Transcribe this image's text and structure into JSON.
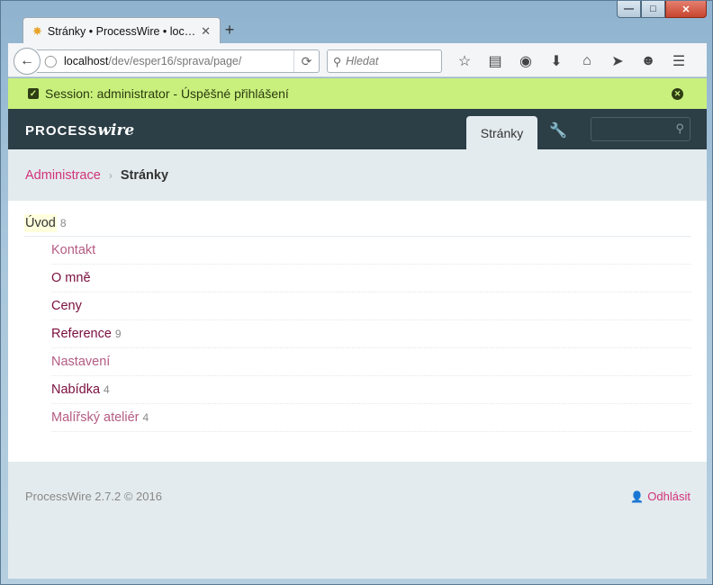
{
  "browser": {
    "tab_title": "Stránky • ProcessWire • loc…",
    "new_tab": "+",
    "url_host": "localhost",
    "url_path": "/dev/esper16/sprava/page/",
    "search_placeholder": "Hledat"
  },
  "notice": {
    "text": "Session: administrator - Úspěšné přihlášení"
  },
  "header": {
    "logo_main": "PROCESS",
    "logo_italic": "wire",
    "nav_tab": "Stránky"
  },
  "breadcrumb": {
    "parent": "Administrace",
    "current": "Stránky"
  },
  "tree": {
    "root": {
      "label": "Úvod",
      "count": "8"
    },
    "children": [
      {
        "label": "Kontakt",
        "count": ""
      },
      {
        "label": "O mně",
        "count": ""
      },
      {
        "label": "Ceny",
        "count": ""
      },
      {
        "label": "Reference",
        "count": "9"
      },
      {
        "label": "Nastavení",
        "count": ""
      },
      {
        "label": "Nabídka",
        "count": "4"
      },
      {
        "label": "Malířský ateliér",
        "count": "4"
      }
    ]
  },
  "footer": {
    "version": "ProcessWire 2.7.2 © 2016",
    "logout": "Odhlásit"
  },
  "colors": {
    "accent": "#d1327a",
    "header_bg": "#2c3e46",
    "notice_bg": "#c9f07d"
  }
}
